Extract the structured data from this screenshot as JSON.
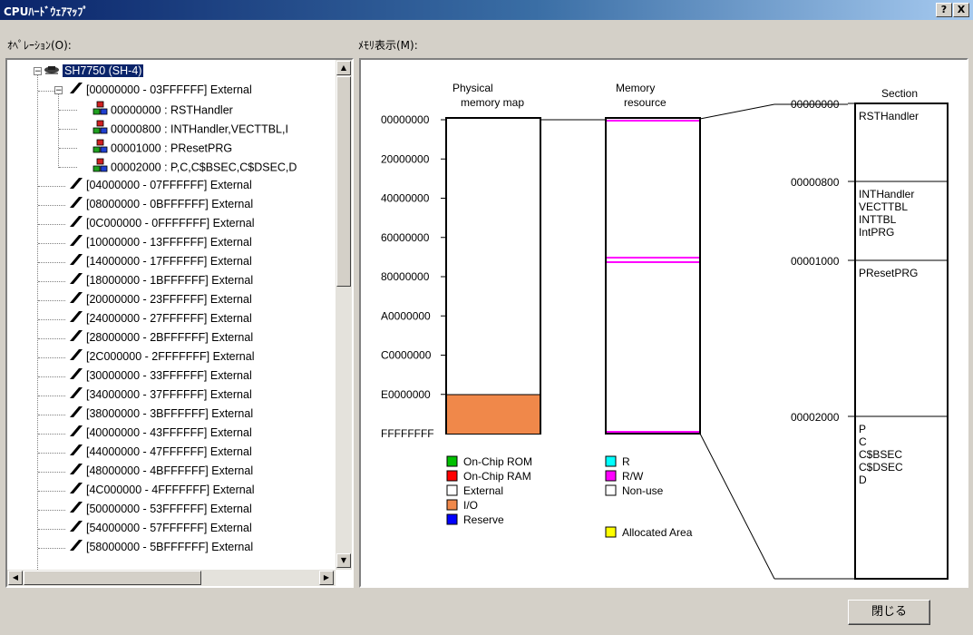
{
  "window": {
    "title": "CPUﾊｰﾄﾞｳｪｱﾏｯﾌﾟ",
    "help_btn": "?",
    "close_btn": "X"
  },
  "operation_label": "ｵﾍﾟﾚｰｼｮﾝ(O):",
  "memory_label": "ﾒﾓﾘ表示(M):",
  "tree": {
    "root": "SH7750 (SH-4)",
    "first_area": "[00000000 - 03FFFFFF] External",
    "sections": [
      "00000000 : RSTHandler",
      "00000800 : INTHandler,VECTTBL,I",
      "00001000 : PResetPRG",
      "00002000 : P,C,C$BSEC,C$DSEC,D"
    ],
    "areas": [
      "[04000000 - 07FFFFFF] External",
      "[08000000 - 0BFFFFFF] External",
      "[0C000000 - 0FFFFFFF] External",
      "[10000000 - 13FFFFFF] External",
      "[14000000 - 17FFFFFF] External",
      "[18000000 - 1BFFFFFF] External",
      "[20000000 - 23FFFFFF] External",
      "[24000000 - 27FFFFFF] External",
      "[28000000 - 2BFFFFFF] External",
      "[2C000000 - 2FFFFFFF] External",
      "[30000000 - 33FFFFFF] External",
      "[34000000 - 37FFFFFF] External",
      "[38000000 - 3BFFFFFF] External",
      "[40000000 - 43FFFFFF] External",
      "[44000000 - 47FFFFFF] External",
      "[48000000 - 4BFFFFFF] External",
      "[4C000000 - 4FFFFFFF] External",
      "[50000000 - 53FFFFFF] External",
      "[54000000 - 57FFFFFF] External",
      "[58000000 - 5BFFFFFF] External"
    ]
  },
  "physical": {
    "title1": "Physical",
    "title2": "memory map",
    "ticks": [
      "00000000",
      "20000000",
      "40000000",
      "60000000",
      "80000000",
      "A0000000",
      "C0000000",
      "E0000000",
      "FFFFFFFF"
    ]
  },
  "resource": {
    "title1": "Memory",
    "title2": "resource"
  },
  "section_map": {
    "title": "Section",
    "addresses": [
      "00000000",
      "00000800",
      "00001000",
      "00002000"
    ],
    "blocks": [
      [
        "RSTHandler"
      ],
      [
        "INTHandler",
        "VECTTBL",
        "INTTBL",
        "IntPRG"
      ],
      [
        "PResetPRG"
      ],
      [
        "P",
        "C",
        "C$BSEC",
        "C$DSEC",
        "D"
      ]
    ]
  },
  "legend_physical": [
    {
      "label": "On-Chip ROM",
      "color": "#00c000"
    },
    {
      "label": "On-Chip RAM",
      "color": "#ff0000"
    },
    {
      "label": "External",
      "color": "#ffffff"
    },
    {
      "label": "I/O",
      "color": "#f0884a"
    },
    {
      "label": "Reserve",
      "color": "#0000ff"
    }
  ],
  "legend_resource": [
    {
      "label": "R",
      "color": "#00ffff"
    },
    {
      "label": "R/W",
      "color": "#ff00ff"
    },
    {
      "label": "Non-use",
      "color": "#ffffff"
    }
  ],
  "legend_allocated": {
    "label": "Allocated Area",
    "color": "#ffff00"
  },
  "close_button": "閉じる"
}
